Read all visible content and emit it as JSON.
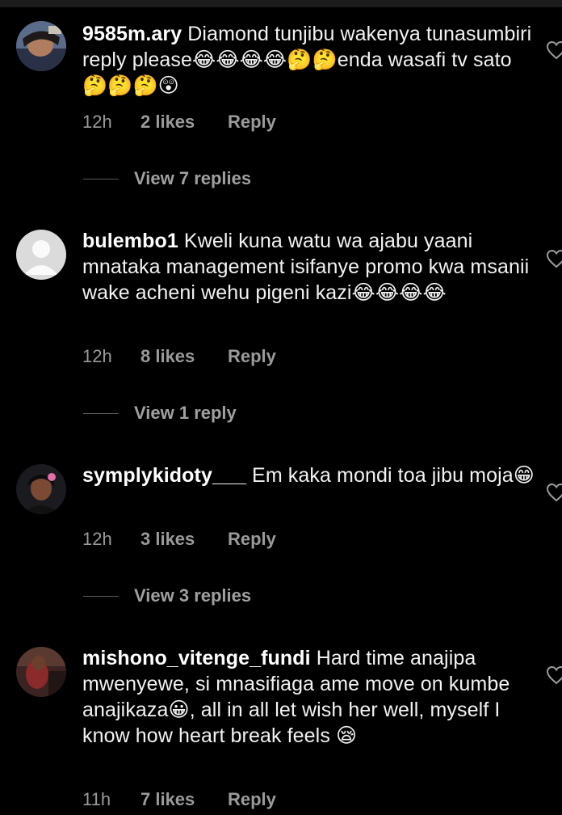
{
  "comments": [
    {
      "username": "9585m.ary",
      "text": "Diamond tunjibu wakenya tunasumbiri reply please😂😂😂😂🤔🤔enda wasafi tv sato🤔🤔🤔😲",
      "time": "12h",
      "likes": "2 likes",
      "reply": "Reply",
      "view_replies": "View 7 replies",
      "avatar_icon": "avatar-photo"
    },
    {
      "username": "bulembo1",
      "text": "Kweli kuna watu wa ajabu yaani mnataka management isifanye promo kwa msanii wake acheni wehu pigeni kazi😂😂😂😂",
      "time": "12h",
      "likes": "8 likes",
      "reply": "Reply",
      "view_replies": "View 1 reply",
      "avatar_icon": "default-avatar"
    },
    {
      "username": "symplykidoty___",
      "text": "Em kaka mondi toa jibu moja😁",
      "time": "12h",
      "likes": "3 likes",
      "reply": "Reply",
      "view_replies": "View 3 replies",
      "avatar_icon": "avatar-photo"
    },
    {
      "username": "mishono_vitenge_fundi",
      "text": "Hard time anajipa mwenyewe, si mnasifiaga ame move on kumbe anajikaza😀, all in all let wish her well, myself I know how heart break feels 😪",
      "time": "11h",
      "likes": "7 likes",
      "reply": "Reply",
      "avatar_icon": "avatar-photo"
    }
  ],
  "colors": {
    "background": "#000000",
    "text": "#f2f2f2",
    "meta": "#9a9a9a"
  },
  "icons": {
    "like": "heart-outline-icon"
  }
}
